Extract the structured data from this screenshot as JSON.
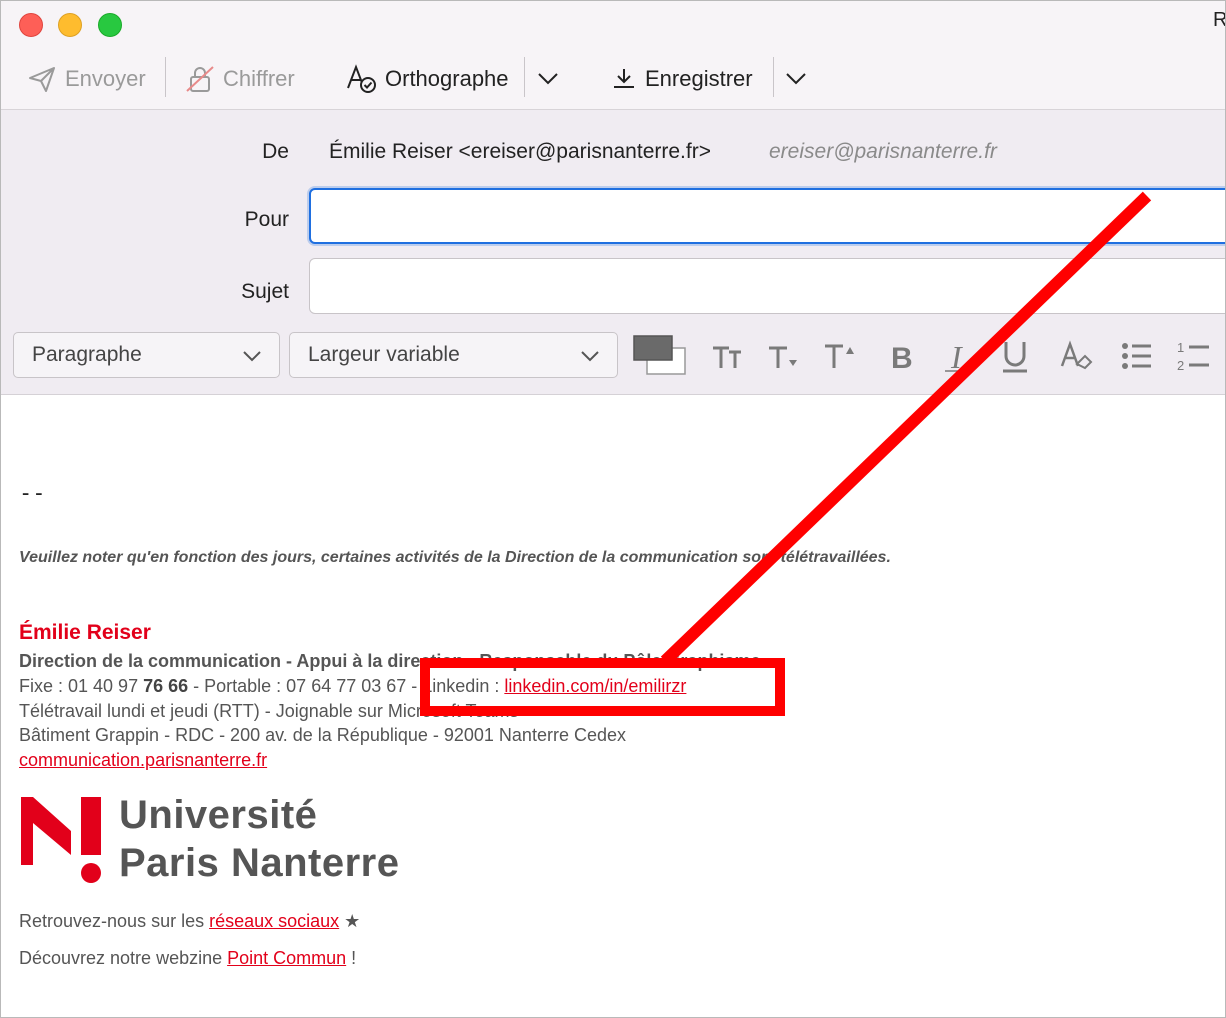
{
  "window": {
    "title_fragment": "R"
  },
  "toolbar": {
    "send_label": "Envoyer",
    "encrypt_label": "Chiffrer",
    "spelling_label": "Orthographe",
    "save_label": "Enregistrer"
  },
  "headers": {
    "from_label": "De",
    "from_value": "Émilie Reiser <ereiser@parisnanterre.fr>",
    "from_identity": "ereiser@parisnanterre.fr",
    "to_label": "Pour",
    "to_value": "",
    "subject_label": "Sujet",
    "subject_value": ""
  },
  "format_bar": {
    "paragraph_select": "Paragraphe",
    "font_select": "Largeur variable"
  },
  "body": {
    "sig_separator": "--",
    "notice": "Veuillez noter qu'en fonction des jours, certaines activités de la Direction de la communication sont télétravaillées.",
    "name": "Émilie Reiser",
    "role": "Direction de la communication - Appui à la direction - Responsable du Pôle Graphisme",
    "phone_prefix": "Fixe : 01 40 97 ",
    "phone_bold": "76 66",
    "phone_rest": " - Portable : 07 64 77 03 67 - Linkedin : ",
    "linkedin": "linkedin.com/in/emilirzr",
    "telework": "Télétravail lundi et jeudi (RTT) - Joignable sur Microsoft Teams",
    "address": "Bâtiment Grappin - RDC - 200 av. de la République - 92001 Nanterre Cedex",
    "website": "communication.parisnanterre.fr",
    "logo_line1": "Université",
    "logo_line2": "Paris Nanterre",
    "social_prefix": "Retrouvez-nous sur les ",
    "social_link": "réseaux sociaux",
    "social_star": " ★",
    "webzine_prefix": "Découvrez notre webzine ",
    "webzine_link": "Point Commun",
    "webzine_suffix": " !"
  },
  "colors": {
    "accent_red": "#e2001a",
    "focus_blue": "#1f6fe0",
    "annotation_red": "#ff0000"
  }
}
